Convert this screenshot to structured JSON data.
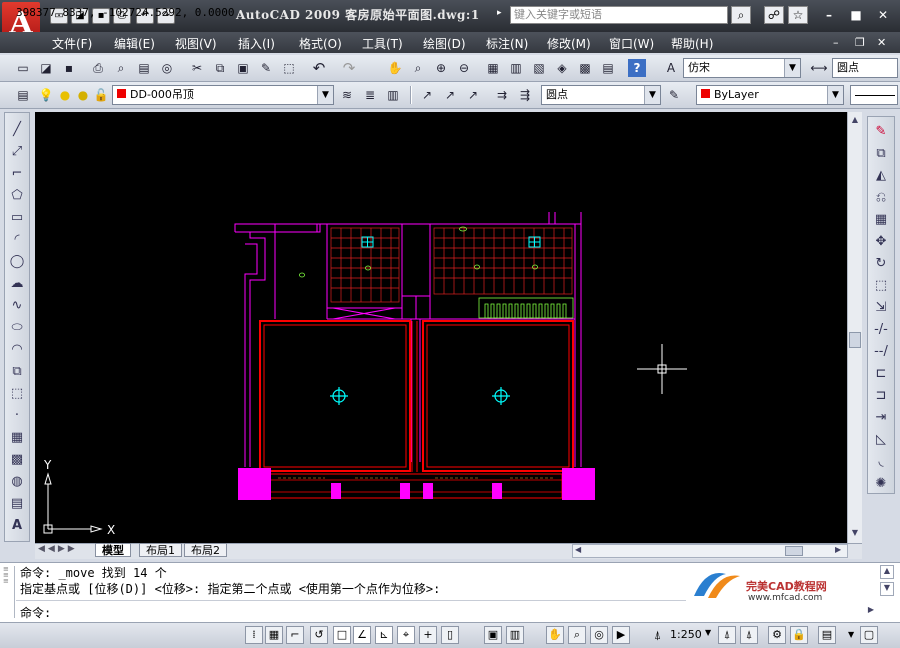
{
  "window": {
    "title": "AutoCAD  2009  客房原始平面图.dwg:1",
    "search_placeholder": "键入关键字或短语",
    "minimize": "–",
    "restore": "■",
    "close": "✕"
  },
  "menu": [
    {
      "label": "文件(F)"
    },
    {
      "label": "编辑(E)"
    },
    {
      "label": "视图(V)"
    },
    {
      "label": "插入(I)"
    },
    {
      "label": "格式(O)"
    },
    {
      "label": "工具(T)"
    },
    {
      "label": "绘图(D)"
    },
    {
      "label": "标注(N)"
    },
    {
      "label": "修改(M)"
    },
    {
      "label": "窗口(W)"
    },
    {
      "label": "帮助(H)"
    }
  ],
  "toolbar": {
    "text_style": "仿宋",
    "dim_style": "圆点",
    "layer": "DD-000吊顶",
    "multileader_style": "圆点",
    "color": "ByLayer"
  },
  "layout_tabs": [
    "模型",
    "布局1",
    "布局2"
  ],
  "command": {
    "line1": "命令:  _move 找到 14 个",
    "line2": "指定基点或 [位移(D)] <位移>:  指定第二个点或 <使用第一个点作为位移>:",
    "prompt": "命令:"
  },
  "watermark": {
    "title": "完美CAD教程网",
    "url": "www.mfcad.com"
  },
  "status": {
    "coordinates": "398377.8337, -102724.5292, 0.0000",
    "annotation_scale": "1:250"
  },
  "ucs": {
    "x": "X",
    "y": "Y"
  },
  "colors": {
    "wall": "#ff00ff",
    "ceiling_edge": "#ff0000",
    "grid": "#ff2020",
    "fixture": "#00ffff",
    "ac": "#90ff40",
    "canvas": "#000000"
  }
}
